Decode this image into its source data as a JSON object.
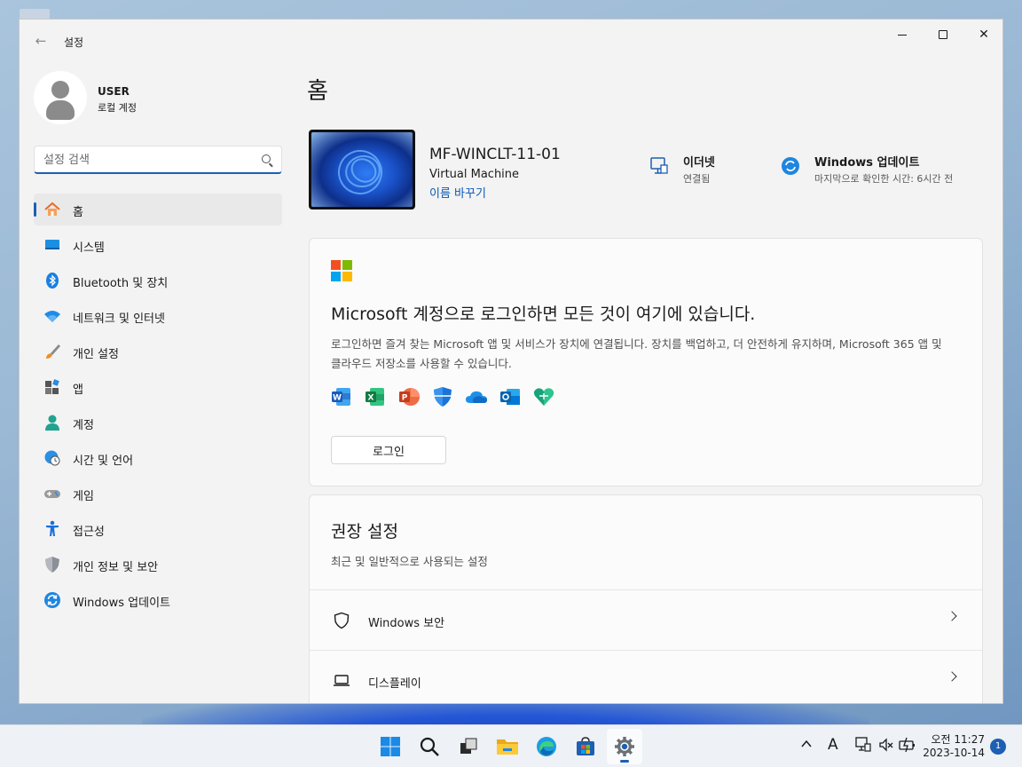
{
  "window": {
    "app_title": "설정"
  },
  "profile": {
    "name": "USER",
    "account_type": "로컬 계정"
  },
  "search": {
    "placeholder": "설정 검색"
  },
  "sidebar": {
    "items": [
      {
        "label": "홈",
        "icon": "home-icon",
        "active": true
      },
      {
        "label": "시스템",
        "icon": "system-icon",
        "active": false
      },
      {
        "label": "Bluetooth 및 장치",
        "icon": "bluetooth-icon",
        "active": false
      },
      {
        "label": "네트워크 및 인터넷",
        "icon": "wifi-icon",
        "active": false
      },
      {
        "label": "개인 설정",
        "icon": "brush-icon",
        "active": false
      },
      {
        "label": "앱",
        "icon": "apps-icon",
        "active": false
      },
      {
        "label": "계정",
        "icon": "account-icon",
        "active": false
      },
      {
        "label": "시간 및 언어",
        "icon": "globe-clock-icon",
        "active": false
      },
      {
        "label": "게임",
        "icon": "gamepad-icon",
        "active": false
      },
      {
        "label": "접근성",
        "icon": "accessibility-icon",
        "active": false
      },
      {
        "label": "개인 정보 및 보안",
        "icon": "shield-icon",
        "active": false
      },
      {
        "label": "Windows 업데이트",
        "icon": "update-icon",
        "active": false
      }
    ]
  },
  "main": {
    "title": "홈",
    "device": {
      "name": "MF-WINCLT-11-01",
      "type": "Virtual Machine",
      "rename_label": "이름 바꾸기"
    },
    "status": {
      "network_title": "이더넷",
      "network_sub": "연결됨",
      "update_title": "Windows 업데이트",
      "update_sub": "마지막으로 확인한 시간: 6시간 전"
    },
    "ms_card": {
      "heading": "Microsoft 계정으로 로그인하면 모든 것이 여기에 있습니다.",
      "description": "로그인하면 즐겨 찾는 Microsoft 앱 및 서비스가 장치에 연결됩니다. 장치를 백업하고, 더 안전하게 유지하며, Microsoft 365 앱 및 클라우드 저장소를 사용할 수 있습니다.",
      "signin_label": "로그인",
      "apps": [
        "word-icon",
        "excel-icon",
        "powerpoint-icon",
        "defender-icon",
        "onedrive-icon",
        "outlook-icon",
        "family-icon"
      ]
    },
    "recommended": {
      "title": "권장 설정",
      "subtitle": "최근 및 일반적으로 사용되는 설정",
      "rows": [
        {
          "label": "Windows 보안",
          "icon": "shield-outline-icon"
        },
        {
          "label": "디스플레이",
          "icon": "laptop-icon"
        }
      ]
    }
  },
  "taskbar": {
    "apps": [
      "start-icon",
      "search-icon",
      "task-view-icon",
      "file-explorer-icon",
      "edge-icon",
      "store-icon",
      "settings-icon"
    ],
    "active_app": "settings-icon",
    "tray_ime": "A",
    "clock_time": "오전 11:27",
    "clock_date": "2023-10-14",
    "notification_count": "1"
  },
  "colors": {
    "accent": "#1d5fb3",
    "window_bg": "#f3f3f3",
    "card_bg": "#fbfbfb"
  }
}
